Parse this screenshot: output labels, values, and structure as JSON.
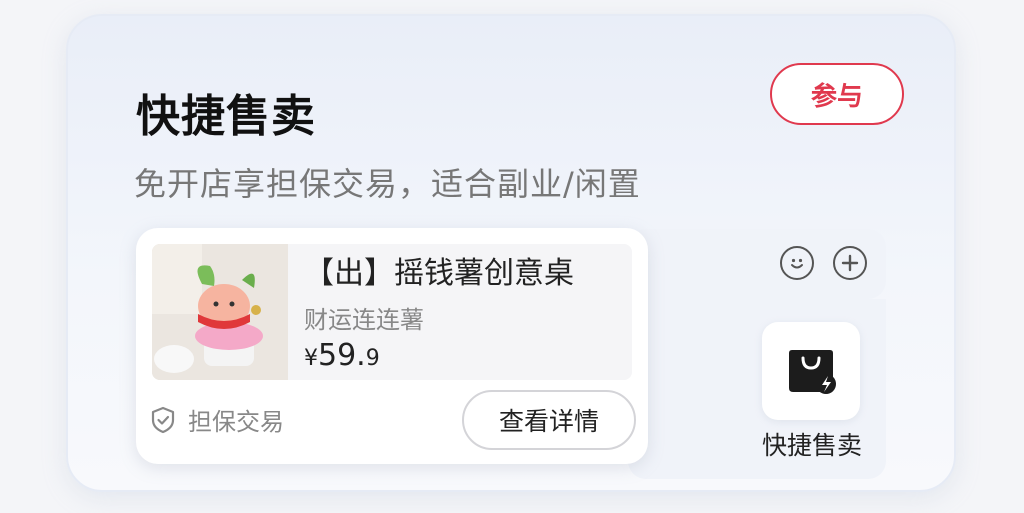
{
  "header": {
    "title": "快捷售卖",
    "join_label": "参与",
    "subtitle": "免开店享担保交易，适合副业/闲置"
  },
  "product": {
    "name": "【出】摇钱薯创意桌",
    "subtitle": "财运连连薯",
    "price_symbol": "¥",
    "price_int": "59.",
    "price_dec": "9",
    "guarantee_label": "担保交易",
    "detail_label": "查看详情"
  },
  "shortcut": {
    "label": "快捷售卖",
    "icon": "shopping-bag-lightning-icon"
  },
  "toolbar_icons": [
    "smile-icon",
    "plus-icon"
  ],
  "colors": {
    "accent": "#e0394e"
  }
}
